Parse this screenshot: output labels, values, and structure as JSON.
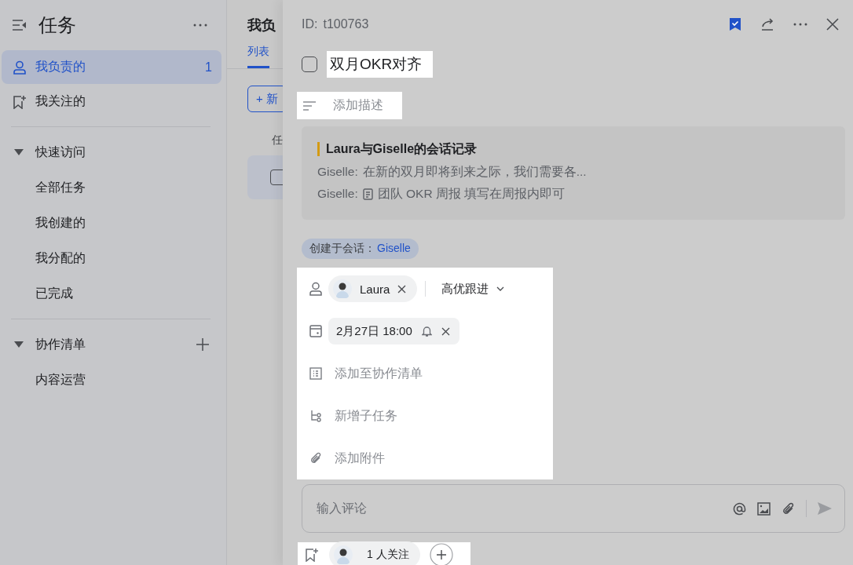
{
  "sidebar": {
    "title": "任务",
    "nav": [
      {
        "kind": "person",
        "label": "我负责的",
        "count": "1",
        "selected": true
      },
      {
        "kind": "follow",
        "label": "我关注的",
        "selected": false
      }
    ],
    "sections": [
      {
        "title": "快速访问",
        "expanded": true,
        "addable": false,
        "items": [
          "全部任务",
          "我创建的",
          "我分配的",
          "已完成"
        ]
      },
      {
        "title": "协作清单",
        "expanded": true,
        "addable": true,
        "items": [
          "内容运营"
        ]
      }
    ]
  },
  "list_panel": {
    "title": "我负",
    "tabs": [
      {
        "label": "列表",
        "selected": true
      }
    ],
    "new_button": {
      "icon": "+",
      "label": "新"
    },
    "column_1": "任",
    "rows": [
      {
        "checked": false,
        "selected": true
      }
    ]
  },
  "detail": {
    "id_label": "ID:",
    "id": "t100763",
    "task": {
      "title": "双月OKR对齐",
      "completed": false
    },
    "description_placeholder": "添加描述",
    "chat_record": {
      "title": "Laura与Giselle的会话记录",
      "lines": [
        {
          "sender": "Giselle:",
          "doc": false,
          "text": "在新的双月即将到来之际，我们需要各..."
        },
        {
          "sender": "Giselle:",
          "doc": true,
          "text": "团队 OKR 周报 填写在周报内即可"
        }
      ]
    },
    "source": {
      "label": "创建于会话：",
      "link": "Giselle"
    },
    "assignee": "Laura",
    "priority": "高优跟进",
    "due": "2月27日 18:00",
    "actions": [
      {
        "kind": "list",
        "label": "添加至协作清单"
      },
      {
        "kind": "subtask",
        "label": "新增子任务"
      },
      {
        "kind": "attachment",
        "label": "添加附件"
      }
    ],
    "comment_placeholder": "输入评论",
    "followers": "1 人关注"
  }
}
